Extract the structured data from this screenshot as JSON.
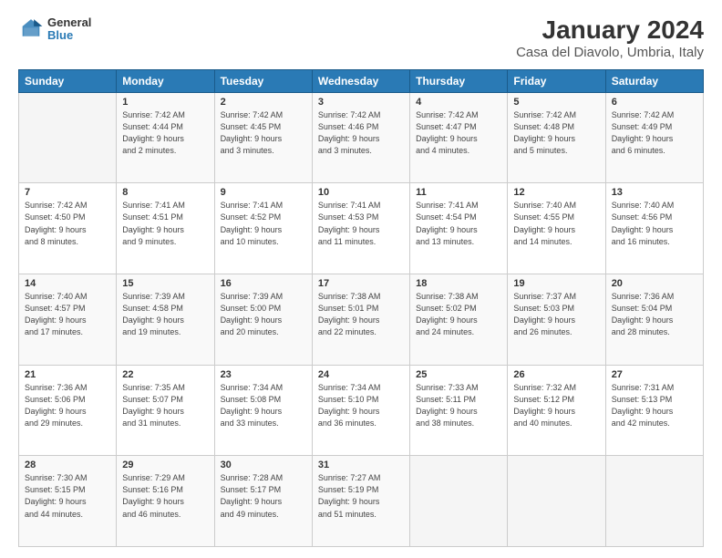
{
  "logo": {
    "line1": "General",
    "line2": "Blue"
  },
  "title": "January 2024",
  "subtitle": "Casa del Diavolo, Umbria, Italy",
  "weekdays": [
    "Sunday",
    "Monday",
    "Tuesday",
    "Wednesday",
    "Thursday",
    "Friday",
    "Saturday"
  ],
  "weeks": [
    [
      {
        "num": "",
        "info": ""
      },
      {
        "num": "1",
        "info": "Sunrise: 7:42 AM\nSunset: 4:44 PM\nDaylight: 9 hours\nand 2 minutes."
      },
      {
        "num": "2",
        "info": "Sunrise: 7:42 AM\nSunset: 4:45 PM\nDaylight: 9 hours\nand 3 minutes."
      },
      {
        "num": "3",
        "info": "Sunrise: 7:42 AM\nSunset: 4:46 PM\nDaylight: 9 hours\nand 3 minutes."
      },
      {
        "num": "4",
        "info": "Sunrise: 7:42 AM\nSunset: 4:47 PM\nDaylight: 9 hours\nand 4 minutes."
      },
      {
        "num": "5",
        "info": "Sunrise: 7:42 AM\nSunset: 4:48 PM\nDaylight: 9 hours\nand 5 minutes."
      },
      {
        "num": "6",
        "info": "Sunrise: 7:42 AM\nSunset: 4:49 PM\nDaylight: 9 hours\nand 6 minutes."
      }
    ],
    [
      {
        "num": "7",
        "info": "Sunrise: 7:42 AM\nSunset: 4:50 PM\nDaylight: 9 hours\nand 8 minutes."
      },
      {
        "num": "8",
        "info": "Sunrise: 7:41 AM\nSunset: 4:51 PM\nDaylight: 9 hours\nand 9 minutes."
      },
      {
        "num": "9",
        "info": "Sunrise: 7:41 AM\nSunset: 4:52 PM\nDaylight: 9 hours\nand 10 minutes."
      },
      {
        "num": "10",
        "info": "Sunrise: 7:41 AM\nSunset: 4:53 PM\nDaylight: 9 hours\nand 11 minutes."
      },
      {
        "num": "11",
        "info": "Sunrise: 7:41 AM\nSunset: 4:54 PM\nDaylight: 9 hours\nand 13 minutes."
      },
      {
        "num": "12",
        "info": "Sunrise: 7:40 AM\nSunset: 4:55 PM\nDaylight: 9 hours\nand 14 minutes."
      },
      {
        "num": "13",
        "info": "Sunrise: 7:40 AM\nSunset: 4:56 PM\nDaylight: 9 hours\nand 16 minutes."
      }
    ],
    [
      {
        "num": "14",
        "info": "Sunrise: 7:40 AM\nSunset: 4:57 PM\nDaylight: 9 hours\nand 17 minutes."
      },
      {
        "num": "15",
        "info": "Sunrise: 7:39 AM\nSunset: 4:58 PM\nDaylight: 9 hours\nand 19 minutes."
      },
      {
        "num": "16",
        "info": "Sunrise: 7:39 AM\nSunset: 5:00 PM\nDaylight: 9 hours\nand 20 minutes."
      },
      {
        "num": "17",
        "info": "Sunrise: 7:38 AM\nSunset: 5:01 PM\nDaylight: 9 hours\nand 22 minutes."
      },
      {
        "num": "18",
        "info": "Sunrise: 7:38 AM\nSunset: 5:02 PM\nDaylight: 9 hours\nand 24 minutes."
      },
      {
        "num": "19",
        "info": "Sunrise: 7:37 AM\nSunset: 5:03 PM\nDaylight: 9 hours\nand 26 minutes."
      },
      {
        "num": "20",
        "info": "Sunrise: 7:36 AM\nSunset: 5:04 PM\nDaylight: 9 hours\nand 28 minutes."
      }
    ],
    [
      {
        "num": "21",
        "info": "Sunrise: 7:36 AM\nSunset: 5:06 PM\nDaylight: 9 hours\nand 29 minutes."
      },
      {
        "num": "22",
        "info": "Sunrise: 7:35 AM\nSunset: 5:07 PM\nDaylight: 9 hours\nand 31 minutes."
      },
      {
        "num": "23",
        "info": "Sunrise: 7:34 AM\nSunset: 5:08 PM\nDaylight: 9 hours\nand 33 minutes."
      },
      {
        "num": "24",
        "info": "Sunrise: 7:34 AM\nSunset: 5:10 PM\nDaylight: 9 hours\nand 36 minutes."
      },
      {
        "num": "25",
        "info": "Sunrise: 7:33 AM\nSunset: 5:11 PM\nDaylight: 9 hours\nand 38 minutes."
      },
      {
        "num": "26",
        "info": "Sunrise: 7:32 AM\nSunset: 5:12 PM\nDaylight: 9 hours\nand 40 minutes."
      },
      {
        "num": "27",
        "info": "Sunrise: 7:31 AM\nSunset: 5:13 PM\nDaylight: 9 hours\nand 42 minutes."
      }
    ],
    [
      {
        "num": "28",
        "info": "Sunrise: 7:30 AM\nSunset: 5:15 PM\nDaylight: 9 hours\nand 44 minutes."
      },
      {
        "num": "29",
        "info": "Sunrise: 7:29 AM\nSunset: 5:16 PM\nDaylight: 9 hours\nand 46 minutes."
      },
      {
        "num": "30",
        "info": "Sunrise: 7:28 AM\nSunset: 5:17 PM\nDaylight: 9 hours\nand 49 minutes."
      },
      {
        "num": "31",
        "info": "Sunrise: 7:27 AM\nSunset: 5:19 PM\nDaylight: 9 hours\nand 51 minutes."
      },
      {
        "num": "",
        "info": ""
      },
      {
        "num": "",
        "info": ""
      },
      {
        "num": "",
        "info": ""
      }
    ]
  ]
}
